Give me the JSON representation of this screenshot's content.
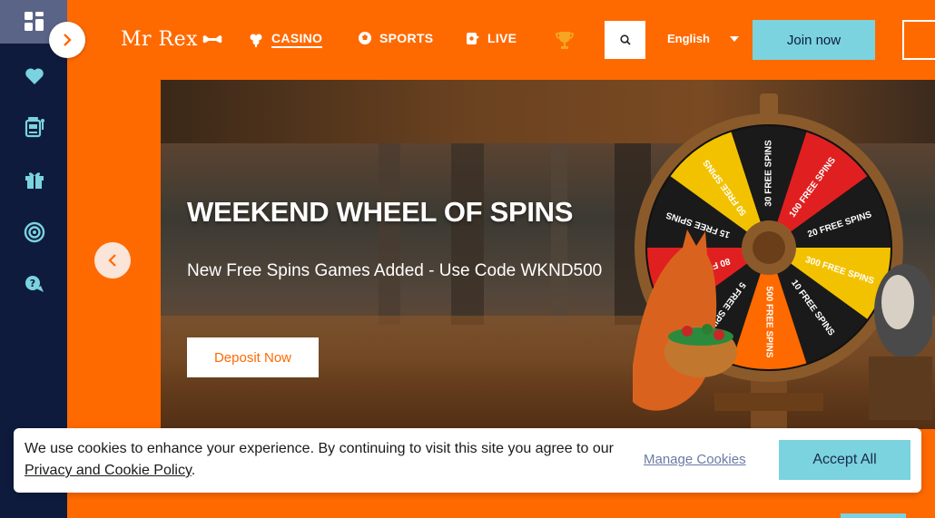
{
  "header": {
    "logo_text": "Mr Rex",
    "nav": [
      {
        "label": "CASINO",
        "icon": "casino-icon",
        "active": true
      },
      {
        "label": "SPORTS",
        "icon": "sports-ball-icon",
        "active": false
      },
      {
        "label": "LIVE",
        "icon": "live-dealer-icon",
        "active": false
      }
    ],
    "language": "English",
    "join_label": "Join now"
  },
  "sidebar": {
    "items": [
      "grid-icon",
      "heart-icon",
      "slot-machine-icon",
      "gift-icon",
      "target-icon",
      "support-icon"
    ]
  },
  "banner": {
    "title": "WEEKEND WHEEL OF SPINS",
    "subtitle": "New Free Spins Games Added - Use Code WKND500",
    "cta_label": "Deposit Now",
    "wheel_segments": [
      "100 FREE SPINS",
      "20 FREE SPINS",
      "300 FREE SPINS",
      "10 FREE SPINS",
      "500 FREE SPINS",
      "5 FREE SPINS",
      "80 FREE SPINS",
      "15 FREE SPINS",
      "50 FREE SPINS",
      "30 FREE SPINS"
    ]
  },
  "cookie": {
    "text_before": "We use cookies to enhance your experience. By continuing to visit this site you agree to our ",
    "policy_link": "Privacy and Cookie Policy",
    "text_after": ".",
    "manage_label": "Manage Cookies",
    "accept_label": "Accept All"
  },
  "colors": {
    "brand_orange": "#ff6a00",
    "sidebar_navy": "#0e1b3d",
    "accent_teal": "#7ad3df"
  }
}
